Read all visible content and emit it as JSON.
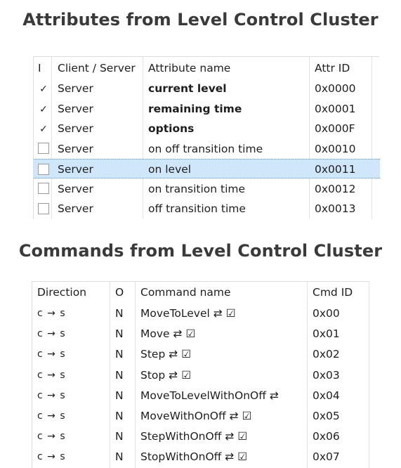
{
  "attributes_section": {
    "title": "Attributes from Level Control Cluster",
    "headers": [
      "I",
      "Client / Server",
      "Attribute name",
      "Attr ID"
    ],
    "rows": [
      {
        "checked": true,
        "side": "Server",
        "name": "current level",
        "id": "0x0000",
        "bold": true,
        "selected": false
      },
      {
        "checked": true,
        "side": "Server",
        "name": "remaining time",
        "id": "0x0001",
        "bold": true,
        "selected": false
      },
      {
        "checked": true,
        "side": "Server",
        "name": "options",
        "id": "0x000F",
        "bold": true,
        "selected": false
      },
      {
        "checked": false,
        "side": "Server",
        "name": "on off transition time",
        "id": "0x0010",
        "bold": false,
        "selected": false
      },
      {
        "checked": false,
        "side": "Server",
        "name": "on level",
        "id": "0x0011",
        "bold": false,
        "selected": true
      },
      {
        "checked": false,
        "side": "Server",
        "name": "on transition time",
        "id": "0x0012",
        "bold": false,
        "selected": false
      },
      {
        "checked": false,
        "side": "Server",
        "name": "off transition time",
        "id": "0x0013",
        "bold": false,
        "selected": false
      }
    ]
  },
  "commands_section": {
    "title": "Commands from Level Control Cluster",
    "headers": [
      "Direction",
      "O",
      "Command name",
      "Cmd ID"
    ],
    "rows": [
      {
        "direction": "c → s",
        "o": "N",
        "name": "MoveToLevel ⇄ ☑",
        "id": "0x00"
      },
      {
        "direction": "c → s",
        "o": "N",
        "name": "Move ⇄ ☑",
        "id": "0x01"
      },
      {
        "direction": "c → s",
        "o": "N",
        "name": "Step ⇄ ☑",
        "id": "0x02"
      },
      {
        "direction": "c → s",
        "o": "N",
        "name": "Stop ⇄ ☑",
        "id": "0x03"
      },
      {
        "direction": "c → s",
        "o": "N",
        "name": "MoveToLevelWithOnOff ⇄",
        "id": "0x04"
      },
      {
        "direction": "c → s",
        "o": "N",
        "name": "MoveWithOnOff ⇄ ☑",
        "id": "0x05"
      },
      {
        "direction": "c → s",
        "o": "N",
        "name": "StepWithOnOff ⇄ ☑",
        "id": "0x06"
      },
      {
        "direction": "c → s",
        "o": "N",
        "name": "StopWithOnOff ⇄ ☑",
        "id": "0x07"
      }
    ]
  },
  "icons": {
    "checkmark": "checkmark-icon",
    "empty_checkbox": "empty-checkbox-icon"
  },
  "colors": {
    "selected_row": "#cfe6fb",
    "heading_text": "#3a3a3a"
  }
}
